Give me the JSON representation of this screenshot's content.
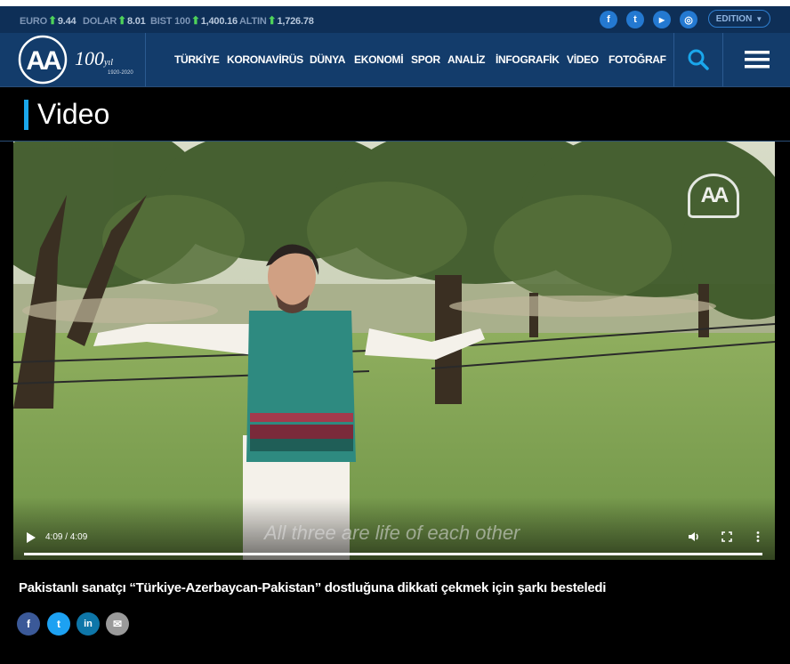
{
  "ticker": [
    {
      "name": "EURO",
      "value": "9.44"
    },
    {
      "name": "DOLAR",
      "value": "8.01"
    },
    {
      "name": "BIST 100",
      "value": "1,400.16"
    },
    {
      "name": "ALTIN",
      "value": "1,726.78"
    }
  ],
  "social_top": [
    {
      "icon": "facebook-icon",
      "glyph": "f"
    },
    {
      "icon": "twitter-icon",
      "glyph": "t"
    },
    {
      "icon": "youtube-icon",
      "glyph": "▶"
    },
    {
      "icon": "instagram-icon",
      "glyph": "◎"
    }
  ],
  "edition": {
    "label": "EDITION"
  },
  "logo": {
    "mark": "AA",
    "anniversary": "100",
    "suffix": "yıl",
    "years": "1920-2020"
  },
  "nav": [
    "TÜRKİYE",
    "KORONAVİRÜS",
    "DÜNYA",
    "EKONOMİ",
    "SPOR",
    "ANALİZ",
    "İNFOGRAFİK",
    "VİDEO",
    "FOTOĞRAF"
  ],
  "section": {
    "title": "Video"
  },
  "video": {
    "time": "4:09 / 4:09",
    "subtitle": "All three are life of each other",
    "watermark": "AA"
  },
  "article": {
    "headline": "Pakistanlı sanatçı “Türkiye-Azerbaycan-Pakistan” dostluğuna dikkati çekmek için şarkı besteledi"
  },
  "share": [
    {
      "icon": "facebook-icon",
      "glyph": "f",
      "color": "#3b5998"
    },
    {
      "icon": "twitter-icon",
      "glyph": "t",
      "color": "#1da1f2"
    },
    {
      "icon": "linkedin-icon",
      "glyph": "in",
      "color": "#0e76a8"
    },
    {
      "icon": "mail-icon",
      "glyph": "✉",
      "color": "#9a9a9a"
    }
  ],
  "colors": {
    "accent": "#1aa7ec",
    "navbar": "#133c6b",
    "ticker": "#0e2f57",
    "up_arrow": "#4fd35a"
  }
}
